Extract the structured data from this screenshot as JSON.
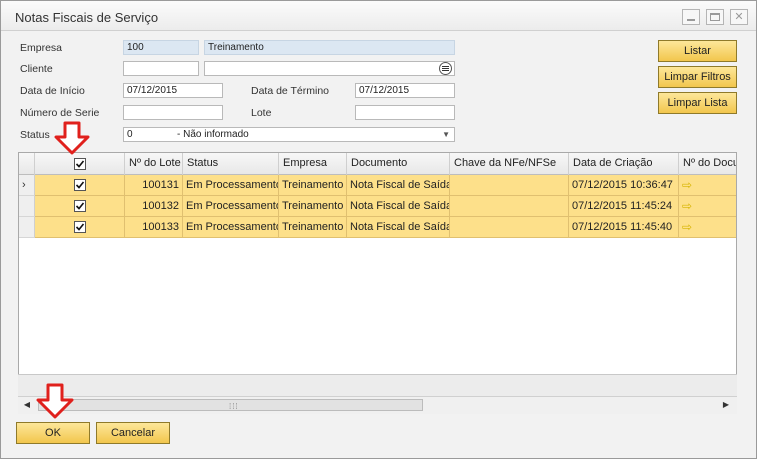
{
  "window": {
    "title": "Notas Fiscais de Serviço"
  },
  "form": {
    "empresa_label": "Empresa",
    "empresa_code": "100",
    "empresa_name": "Treinamento",
    "cliente_label": "Cliente",
    "cliente_code": "",
    "cliente_name": "",
    "data_inicio_label": "Data de Início",
    "data_inicio_value": "07/12/2015",
    "data_termino_label": "Data de Término",
    "data_termino_value": "07/12/2015",
    "numero_serie_label": "Número de Serie",
    "numero_serie_value": "",
    "lote_label": "Lote",
    "lote_value": "",
    "status_label": "Status",
    "status_code": "0",
    "status_text": "- Não informado"
  },
  "actions": {
    "listar": "Listar",
    "limpar_filtros": "Limpar Filtros",
    "limpar_lista": "Limpar Lista",
    "ok": "OK",
    "cancelar": "Cancelar"
  },
  "grid": {
    "columns": [
      "Nº do Lote",
      "Status",
      "Empresa",
      "Documento",
      "Chave da NFe/NFSe",
      "Data de Criação",
      "Nº do Docu"
    ],
    "rows": [
      {
        "lote": "100131",
        "status": "Em Processamento",
        "empresa": "Treinamento",
        "documento": "Nota Fiscal de Saída",
        "chave": "",
        "data": "07/12/2015 10:36:47",
        "checked": true,
        "current": true
      },
      {
        "lote": "100132",
        "status": "Em Processamento",
        "empresa": "Treinamento",
        "documento": "Nota Fiscal de Saída",
        "chave": "",
        "data": "07/12/2015 11:45:24",
        "checked": true,
        "current": false
      },
      {
        "lote": "100133",
        "status": "Em Processamento",
        "empresa": "Treinamento",
        "documento": "Nota Fiscal de Saída",
        "chave": "",
        "data": "07/12/2015 11:45:40",
        "checked": true,
        "current": false
      }
    ]
  },
  "colors": {
    "row_highlight": "#fde08a",
    "button_gold": "#f2c64d",
    "annotation_red": "#e0201c",
    "link_arrow": "#d7b400"
  },
  "icons": {
    "checkbox": "check-icon",
    "row_marker": "chevron-right-icon",
    "link": "link-arrow-icon",
    "picker": "list-picker-icon",
    "annotation": "red-down-arrow"
  }
}
